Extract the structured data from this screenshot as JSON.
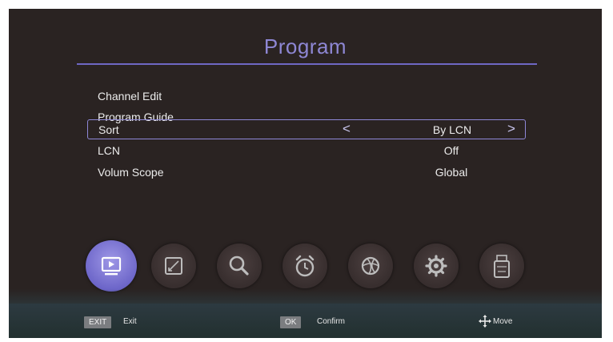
{
  "header": {
    "title": "Program"
  },
  "menu": {
    "items": [
      {
        "label": "Channel Edit",
        "value": ""
      },
      {
        "label": "Program Guide",
        "value": ""
      },
      {
        "label": "Sort",
        "value": "By LCN",
        "prev": "<",
        "next": ">"
      },
      {
        "label": "LCN",
        "value": "Off"
      },
      {
        "label": "Volum Scope",
        "value": "Global"
      }
    ]
  },
  "icon_bar": {
    "icons": [
      "program-icon",
      "picture-icon",
      "search-icon",
      "alarm-clock-icon",
      "globe-icon",
      "settings-gear-icon",
      "usb-icon"
    ],
    "active_color": "#6d66c9"
  },
  "footer": {
    "exit_key": "EXIT",
    "exit_label": "Exit",
    "ok_key": "OK",
    "ok_label": "Confirm",
    "move_label": "Move"
  },
  "colors": {
    "accent": "#8e87d4",
    "background": "#2a2322"
  }
}
